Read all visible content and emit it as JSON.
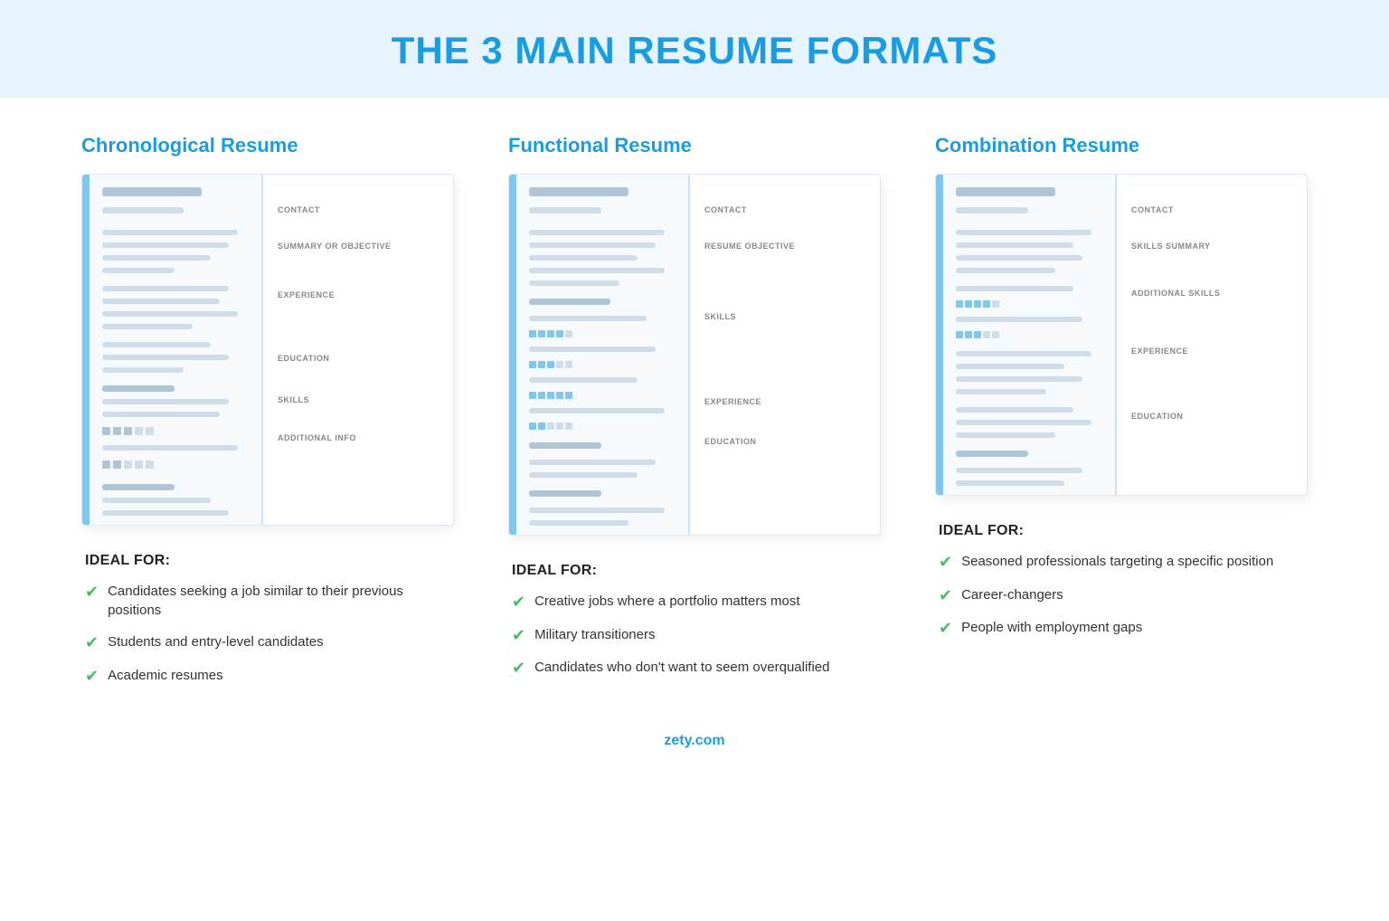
{
  "page": {
    "title": "THE 3 MAIN RESUME FORMATS"
  },
  "columns": [
    {
      "title": "Chronological Resume",
      "labels": [
        "CONTACT",
        "SUMMARY OR OBJECTIVE",
        "EXPERIENCE",
        "EDUCATION",
        "SKILLS",
        "ADDITIONAL INFO"
      ],
      "idealFor": {
        "title": "IDEAL FOR:",
        "items": [
          "Candidates seeking a job similar\nto their previous positions",
          "Students and entry-level candidates",
          "Academic resumes"
        ]
      }
    },
    {
      "title": "Functional Resume",
      "labels": [
        "CONTACT",
        "RESUME OBJECTIVE",
        "SKILLS",
        "EXPERIENCE",
        "EDUCATION"
      ],
      "idealFor": {
        "title": "IDEAL FOR:",
        "items": [
          "Creative jobs where a portfolio\nmatters most",
          "Military transitioners",
          "Candidates who don't want\nto seem overqualified"
        ]
      }
    },
    {
      "title": "Combination Resume",
      "labels": [
        "CONTACT",
        "SKILLS SUMMARY",
        "ADDITIONAL SKILLS",
        "EXPERIENCE",
        "EDUCATION"
      ],
      "idealFor": {
        "title": "IDEAL FOR:",
        "items": [
          "Seasoned professionals targeting\na specific position",
          "Career-changers",
          "People with employment gaps"
        ]
      }
    }
  ],
  "footer": {
    "logo": "zety.com"
  }
}
